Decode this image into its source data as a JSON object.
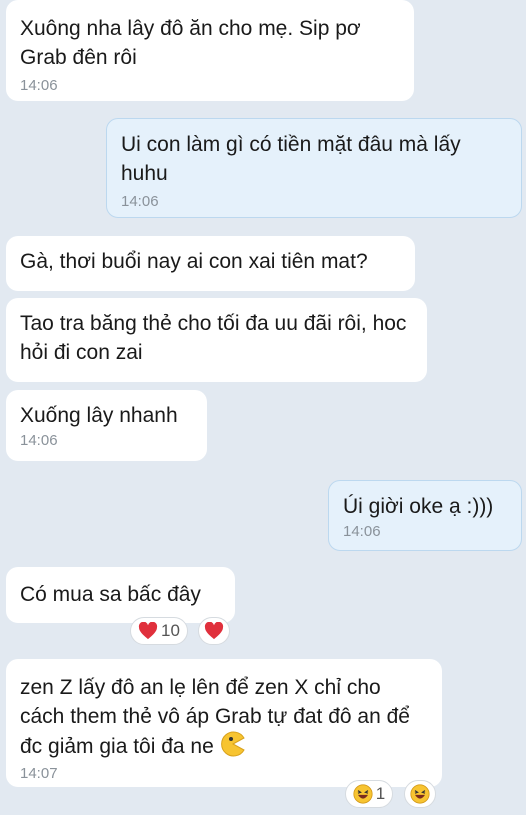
{
  "messages": [
    {
      "text": "Xuông nha lây đô ăn cho mẹ. Sip pơ Grab đên rôi",
      "time": "14:06"
    },
    {
      "text": "Ui con làm gì có tiền mặt đâu mà lấy huhu",
      "time": "14:06"
    },
    {
      "text": "Gà, thơi buổi nay ai con xai tiên mat?"
    },
    {
      "text": "Tao tra băng thẻ cho tối đa uu đãi rôi, hoc hỏi đi con zai"
    },
    {
      "text": "Xuống lây nhanh",
      "time": "14:06"
    },
    {
      "text": "Úi giời oke ạ :)))",
      "time": "14:06"
    },
    {
      "text": "Có mua sa bấc đây",
      "reaction_count": "10",
      "reaction_icon": "heart-icon"
    },
    {
      "text": "zen Z lấy đô an lẹ lên để zen X chỉ cho cách them thẻ vô áp Grab tự đat đô an để đc giảm gia tôi đa ne",
      "time": "14:07",
      "inline_emoji": "pacman-icon",
      "reaction_count": "1",
      "reaction_icon": "laughing-face-icon"
    }
  ],
  "colors": {
    "background": "#e2e9f1",
    "incoming_bubble": "#ffffff",
    "outgoing_bubble": "#e5f1fb",
    "heart": "#e0303c",
    "emoji_yellow": "#f7c431"
  }
}
